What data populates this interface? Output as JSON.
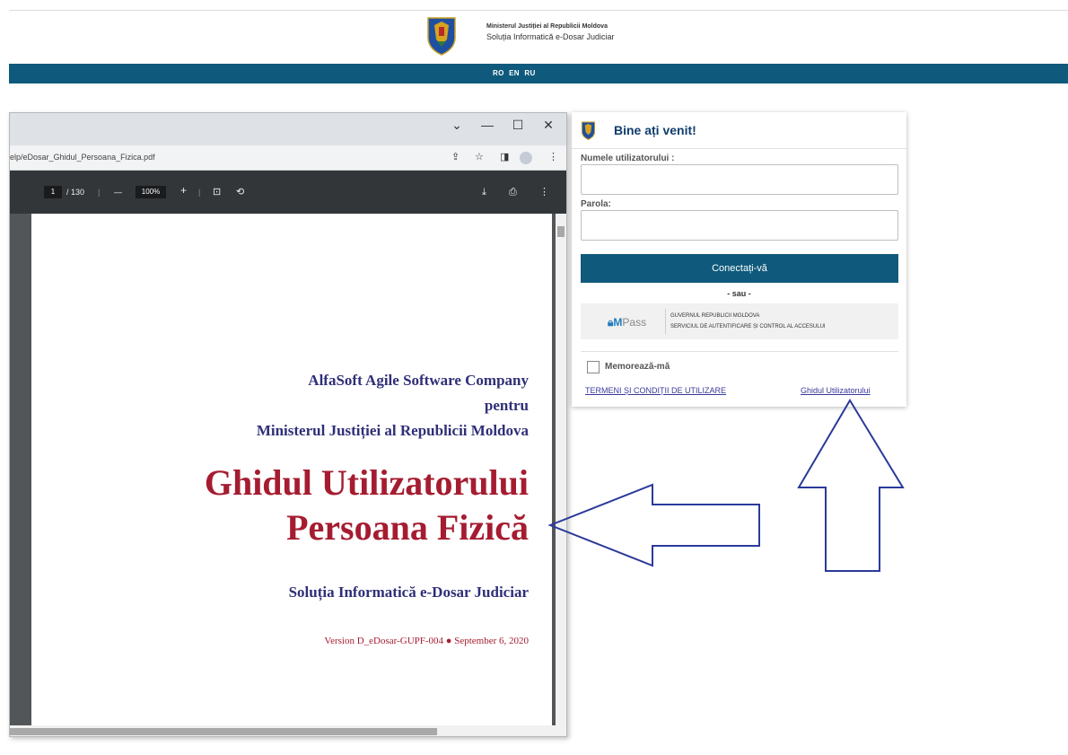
{
  "header": {
    "ministry": "Ministerul Justiției al Republicii Moldova",
    "solution": "Soluția Informatică e-Dosar Judiciar"
  },
  "languages": [
    "RO",
    "EN",
    "RU"
  ],
  "browser": {
    "url": "elp/eDosar_Ghidul_Persoana_Fizica.pdf",
    "window_controls": {
      "chevron": "⌄",
      "minimize": "—",
      "maximize": "☐",
      "close": "✕"
    },
    "pdf_toolbar": {
      "page_current": "1",
      "page_total": "/ 130",
      "zoom_minus": "—",
      "zoom_value": "100%",
      "zoom_plus": "+"
    }
  },
  "pdf_page": {
    "company": "AlfaSoft Agile Software Company",
    "for": "pentru",
    "client": "Ministerul Justiției al Republicii Moldova",
    "title_line1": "Ghidul Utilizatorului",
    "title_line2": "Persoana Fizică",
    "subtitle": "Soluția Informatică e-Dosar Judiciar",
    "version": "Version D_eDosar-GUPF-004 ● September 6, 2020"
  },
  "login": {
    "title": "Bine ați venit!",
    "username_label": "Numele utilizatorului :",
    "password_label": "Parola:",
    "submit_label": "Conectați-vă",
    "or_label": "- sau -",
    "mpass": {
      "logo_m": "M",
      "logo_rest": "Pass",
      "line1": "GUVERNUL REPUBLICII MOLDOVA",
      "line2": "SERVICIUL DE AUTENTIFICARE ȘI CONTROL AL ACCESULUI"
    },
    "remember_label": "Memorează-mă",
    "terms_link": "TERMENI ȘI CONDIȚII DE UTILIZARE",
    "guide_link": "Ghidul Utilizatorului"
  },
  "colors": {
    "brand_blue": "#0f5a7c",
    "title_navy": "#2f2f78",
    "title_red": "#a51c30",
    "arrow": "#2a3a99"
  },
  "icons": [
    "emblem-icon",
    "chevron-down-icon",
    "minimize-icon",
    "maximize-icon",
    "close-icon",
    "share-icon",
    "star-icon",
    "side-panel-icon",
    "profile-icon",
    "kebab-menu-icon",
    "fit-page-icon",
    "rotate-icon",
    "download-icon",
    "print-icon",
    "lock-icon",
    "arrow-left-icon",
    "arrow-up-icon"
  ]
}
